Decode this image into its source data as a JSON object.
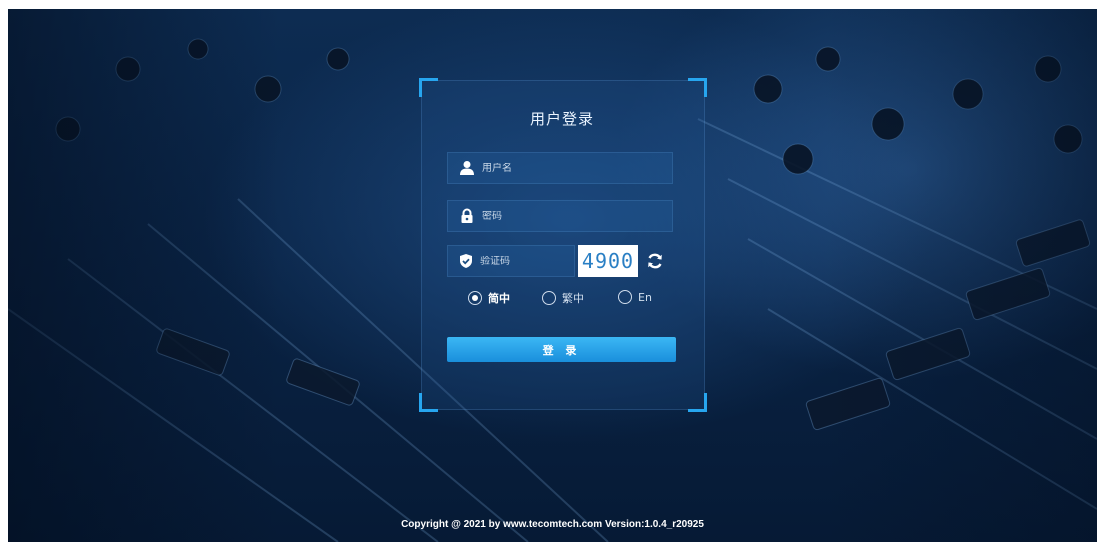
{
  "login": {
    "title": "用户登录",
    "username_placeholder": "用户名",
    "password_placeholder": "密码",
    "captcha_placeholder": "验证码",
    "captcha_code": "4900",
    "submit_label": "登 录"
  },
  "languages": [
    {
      "label": "简中",
      "selected": true
    },
    {
      "label": "繁中",
      "selected": false
    },
    {
      "label": "En",
      "selected": false
    }
  ],
  "footer": {
    "copyright": "Copyright @ 2021 by www.tecomtech.com Version:1.0.4_r20925"
  },
  "colors": {
    "accent": "#27a6ef",
    "button": "#1f97e2",
    "background_dark": "#0a2446"
  },
  "icons": [
    "user-icon",
    "lock-icon",
    "shield-check-icon",
    "refresh-icon"
  ]
}
